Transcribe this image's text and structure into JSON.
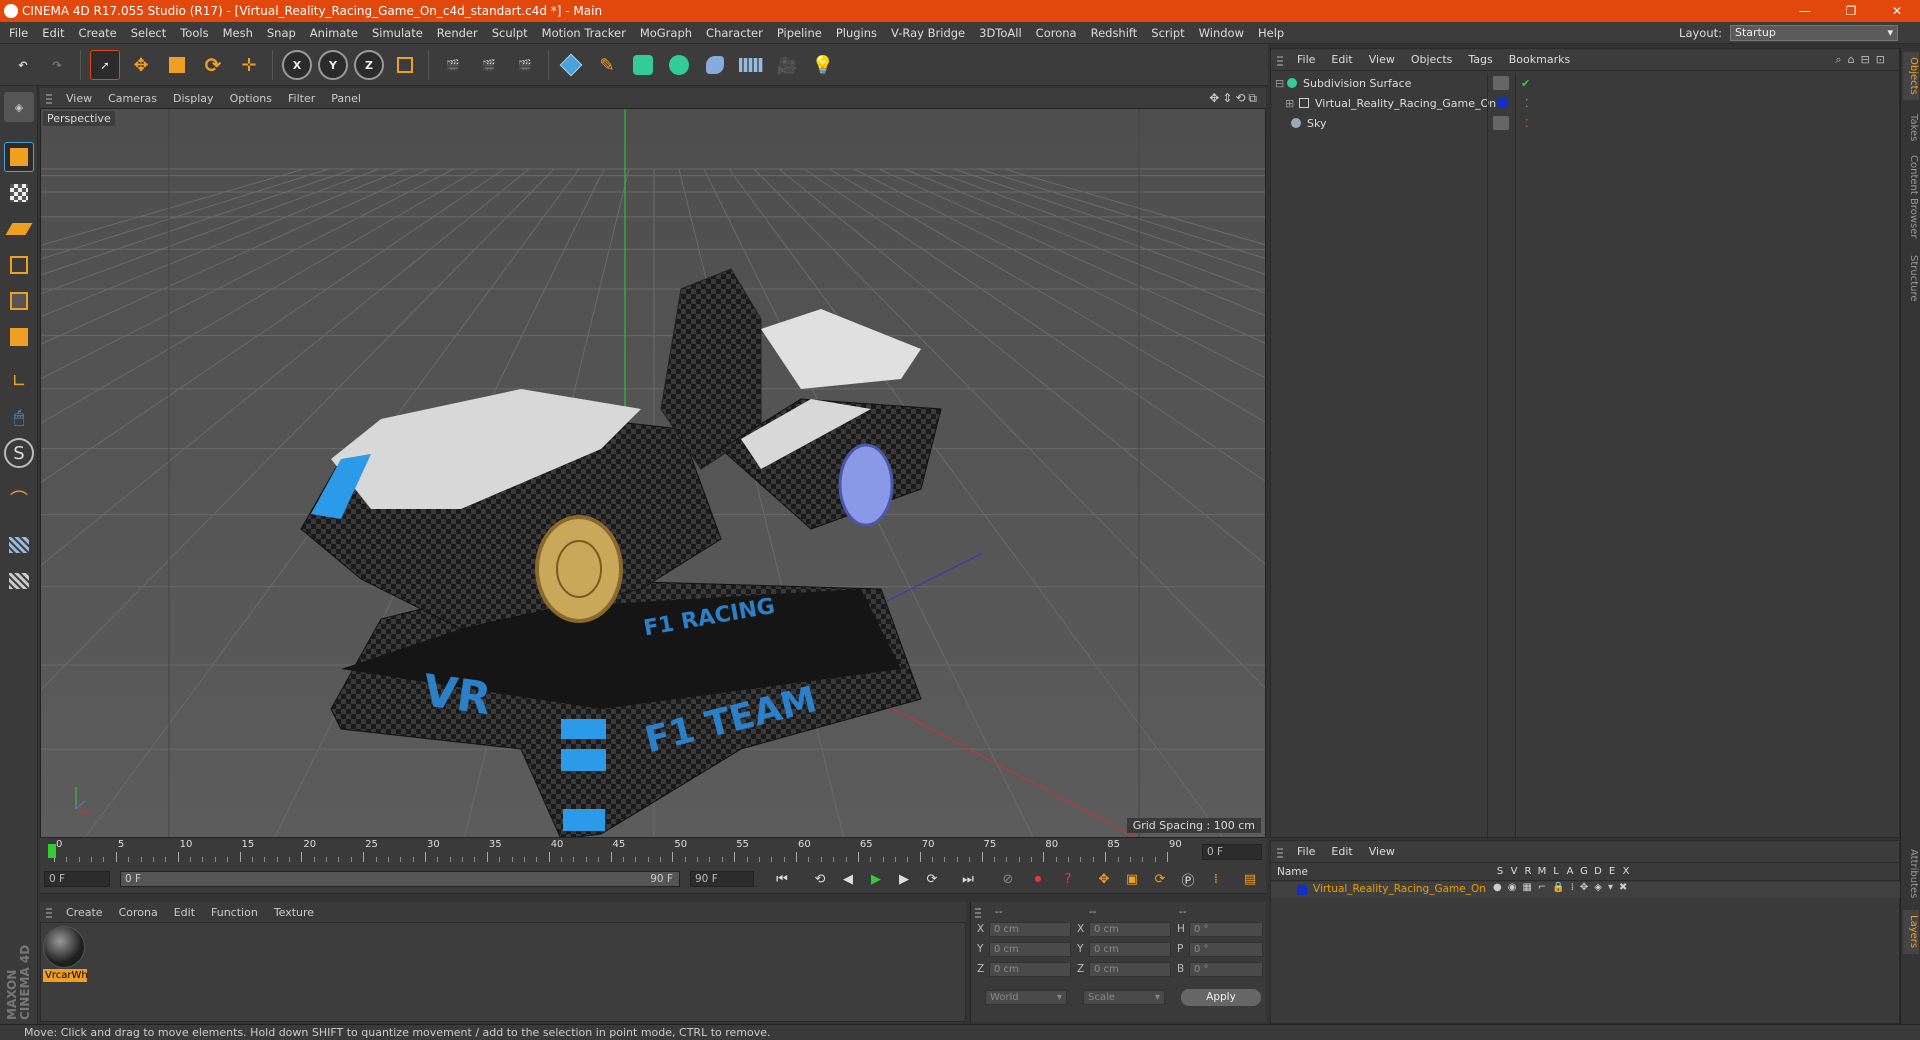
{
  "app": {
    "title": "CINEMA 4D R17.055 Studio (R17) - [Virtual_Reality_Racing_Game_On_c4d_standart.c4d *] - Main",
    "brand_color": "#e2470c"
  },
  "menubar": {
    "items": [
      "File",
      "Edit",
      "Create",
      "Select",
      "Tools",
      "Mesh",
      "Snap",
      "Animate",
      "Simulate",
      "Render",
      "Sculpt",
      "Motion Tracker",
      "MoGraph",
      "Character",
      "Pipeline",
      "Plugins",
      "V-Ray Bridge",
      "3DToAll",
      "Corona",
      "Redshift",
      "Script",
      "Window",
      "Help"
    ],
    "layout_label": "Layout:",
    "layout_value": "Startup"
  },
  "toolbar": {
    "axis_x": "X",
    "axis_y": "Y",
    "axis_z": "Z"
  },
  "viewport": {
    "menu": [
      "View",
      "Cameras",
      "Display",
      "Options",
      "Filter",
      "Panel"
    ],
    "label": "Perspective",
    "grid_spacing": "Grid Spacing : 100 cm",
    "model_text_vr": "VR",
    "model_text_team": "F1 TEAM",
    "model_text_racing": "F1 RACING"
  },
  "timeline": {
    "ticks": [
      "0",
      "5",
      "10",
      "15",
      "20",
      "25",
      "30",
      "35",
      "40",
      "45",
      "50",
      "55",
      "60",
      "65",
      "70",
      "75",
      "80",
      "85",
      "90"
    ],
    "end_frame_field": "0 F"
  },
  "transport": {
    "current_frame": "0 F",
    "range_start": "0 F",
    "range_end": "90 F",
    "max_frame": "90 F"
  },
  "material_manager": {
    "menu": [
      "Create",
      "Corona",
      "Edit",
      "Function",
      "Texture"
    ],
    "material_name": "VrcarWh"
  },
  "coordinates": {
    "headers": [
      "--",
      "--",
      "--"
    ],
    "rows": [
      {
        "a": "X",
        "av": "0 cm",
        "b": "X",
        "bv": "0 cm",
        "c": "H",
        "cv": "0 °"
      },
      {
        "a": "Y",
        "av": "0 cm",
        "b": "Y",
        "bv": "0 cm",
        "c": "P",
        "cv": "0 °"
      },
      {
        "a": "Z",
        "av": "0 cm",
        "b": "Z",
        "bv": "0 cm",
        "c": "B",
        "cv": "0 °"
      }
    ],
    "mode": "World",
    "scale_mode": "Scale",
    "apply": "Apply"
  },
  "object_manager": {
    "menu": [
      "File",
      "Edit",
      "View",
      "Objects",
      "Tags",
      "Bookmarks"
    ],
    "objects": [
      {
        "name": "Subdivision Surface"
      },
      {
        "name": "Virtual_Reality_Racing_Game_On"
      },
      {
        "name": "Sky"
      }
    ]
  },
  "layer_manager": {
    "menu": [
      "File",
      "Edit",
      "View"
    ],
    "name_header": "Name",
    "flags": [
      "S",
      "V",
      "R",
      "M",
      "L",
      "A",
      "G",
      "D",
      "E",
      "X"
    ],
    "layer_name": "Virtual_Reality_Racing_Game_On",
    "layer_color": "#e8a000"
  },
  "right_tabs": [
    "Objects",
    "Takes",
    "Content Browser",
    "Structure",
    "Attributes",
    "Layers"
  ],
  "maxon_logo": "MAXON CINEMA 4D",
  "status": "Move: Click and drag to move elements. Hold down SHIFT to quantize movement / add to the selection in point mode, CTRL to remove."
}
